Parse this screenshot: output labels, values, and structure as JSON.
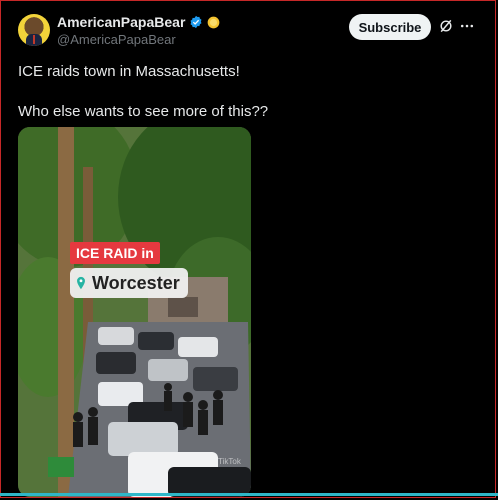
{
  "author": {
    "display_name": "AmericanPapaBear",
    "handle": "@AmericaPapaBear",
    "verified": true,
    "avatar_icon": "bear-in-suit-avatar",
    "badge_icon": "gold-circle-badge"
  },
  "actions": {
    "subscribe_label": "Subscribe",
    "grok_icon": "grok-icon",
    "more_icon": "more-options-icon"
  },
  "tweet": {
    "line1": "ICE raids town in Massachusetts!",
    "line2": "Who else wants to see more of this??"
  },
  "media": {
    "overlay_title": "ICE RAID in",
    "overlay_location": "Worcester",
    "watermark": "TikTok",
    "description_icon": "location-pin-icon"
  },
  "colors": {
    "background": "#000000",
    "text": "#e7e9ea",
    "secondary_text": "#71767b",
    "verified_blue": "#1d9bf0",
    "badge_gold": "#f4c430",
    "overlay_red": "#e5393f",
    "frame_red": "#c62828",
    "bottom_rule": "#2fb7c8"
  }
}
